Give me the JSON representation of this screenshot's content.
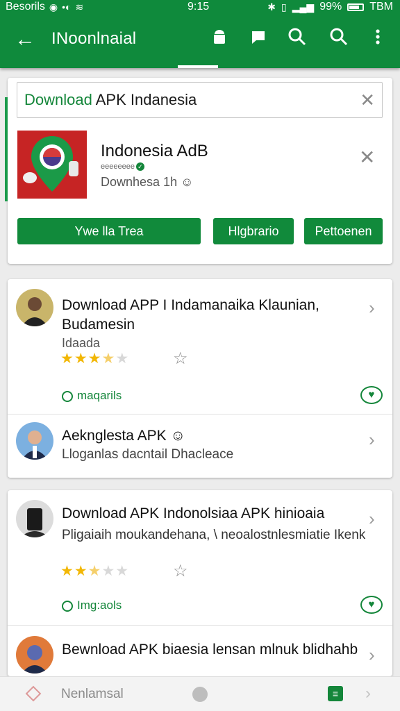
{
  "statusbar": {
    "carrier": "Besorils",
    "time": "9:15",
    "battery": "99%",
    "network": "TBM"
  },
  "toolbar": {
    "title": "INoonlnaial"
  },
  "search": {
    "query_prefix": "Download",
    "query_rest": " APK Indanesia"
  },
  "app": {
    "name": "Indonesia AdB",
    "developer": "eeeeeeee",
    "downloads": "Downhesa 1h"
  },
  "buttons": {
    "primary": "Ywe lla Trea",
    "secondary": "Hlgbrario",
    "tertiary": "Pettoenen"
  },
  "items": [
    {
      "title": "Download APP I Indamanaika Klaunian, Budamesin",
      "subtitle": "Idaada",
      "rating": 3,
      "meta": "maqarils"
    },
    {
      "title": "Aeknglesta APK",
      "description": "Lloganlas dacntail Dhacleace"
    },
    {
      "title": "Download APK Indonolsiaa APK hinioaia",
      "description": "Pligaiaih moukandehana, \\ neoalostnlesmiatie Ikenk",
      "rating": 2.5,
      "meta": "Img:aols"
    },
    {
      "title": "Bewnload APK biaesia lensan mlnuk blidhahb"
    }
  ],
  "bottombar": {
    "label": "Nenlamsal"
  },
  "colors": {
    "primary": "#0f8a3c",
    "accent": "#14863a",
    "star": "#f2b705"
  }
}
